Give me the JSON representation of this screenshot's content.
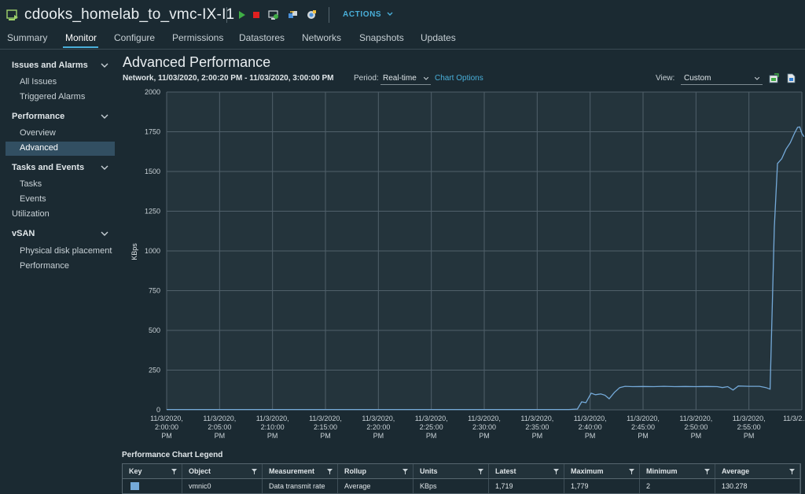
{
  "header": {
    "vm_name": "cdooks_homelab_to_vmc-IX-I1",
    "actions_label": "ACTIONS"
  },
  "tabs": [
    "Summary",
    "Monitor",
    "Configure",
    "Permissions",
    "Datastores",
    "Networks",
    "Snapshots",
    "Updates"
  ],
  "active_tab": "Monitor",
  "sidebar": {
    "groups": [
      {
        "label": "Issues and Alarms",
        "items": [
          "All Issues",
          "Triggered Alarms"
        ]
      },
      {
        "label": "Performance",
        "items": [
          "Overview",
          "Advanced"
        ]
      },
      {
        "label": "Tasks and Events",
        "items": [
          "Tasks",
          "Events"
        ]
      },
      {
        "label": "Utilization"
      },
      {
        "label": "vSAN",
        "items": [
          "Physical disk placement",
          "Performance"
        ]
      }
    ],
    "active_item": "Advanced"
  },
  "page": {
    "title": "Advanced Performance",
    "range": "Network, 11/03/2020, 2:00:20 PM - 11/03/2020, 3:00:00 PM",
    "period_label": "Period:",
    "period_value": "Real-time",
    "chart_options": "Chart Options",
    "view_label": "View:",
    "view_value": "Custom"
  },
  "chart_data": {
    "type": "line",
    "ylabel": "KBps",
    "ylim": [
      0,
      2000
    ],
    "yticks": [
      0,
      250,
      500,
      750,
      1000,
      1250,
      1500,
      1750,
      2000
    ],
    "xticks": [
      [
        "11/3/2020,",
        "2:00:00",
        "PM"
      ],
      [
        "11/3/2020,",
        "2:05:00",
        "PM"
      ],
      [
        "11/3/2020,",
        "2:10:00",
        "PM"
      ],
      [
        "11/3/2020,",
        "2:15:00",
        "PM"
      ],
      [
        "11/3/2020,",
        "2:20:00",
        "PM"
      ],
      [
        "11/3/2020,",
        "2:25:00",
        "PM"
      ],
      [
        "11/3/2020,",
        "2:30:00",
        "PM"
      ],
      [
        "11/3/2020,",
        "2:35:00",
        "PM"
      ],
      [
        "11/3/2020,",
        "2:40:00",
        "PM"
      ],
      [
        "11/3/2020,",
        "2:45:00",
        "PM"
      ],
      [
        "11/3/2020,",
        "2:50:00",
        "PM"
      ],
      [
        "11/3/2020,",
        "2:55:00",
        "PM"
      ],
      [
        "11/3/2..."
      ]
    ],
    "xlim": [
      0,
      60
    ],
    "grid": true,
    "series": [
      {
        "name": "vmnic0",
        "color": "#74a9d8",
        "points": [
          [
            0,
            2
          ],
          [
            5,
            2
          ],
          [
            10,
            2
          ],
          [
            15,
            2
          ],
          [
            20,
            2
          ],
          [
            25,
            2
          ],
          [
            30,
            2
          ],
          [
            35,
            2
          ],
          [
            38,
            2
          ],
          [
            38.8,
            5
          ],
          [
            39.2,
            50
          ],
          [
            39.6,
            45
          ],
          [
            40.1,
            105
          ],
          [
            40.5,
            95
          ],
          [
            41.0,
            100
          ],
          [
            41.4,
            92
          ],
          [
            41.8,
            70
          ],
          [
            42.3,
            110
          ],
          [
            42.8,
            140
          ],
          [
            43.3,
            148
          ],
          [
            44,
            146
          ],
          [
            45,
            147
          ],
          [
            46,
            146
          ],
          [
            47,
            148
          ],
          [
            48,
            146
          ],
          [
            49,
            147
          ],
          [
            50,
            146
          ],
          [
            51,
            147
          ],
          [
            52,
            146
          ],
          [
            52.5,
            140
          ],
          [
            53,
            146
          ],
          [
            53.5,
            125
          ],
          [
            54,
            150
          ],
          [
            55,
            148
          ],
          [
            56,
            148
          ],
          [
            56.6,
            140
          ],
          [
            57.0,
            130
          ],
          [
            57.4,
            1150
          ],
          [
            57.7,
            1550
          ],
          [
            58.1,
            1580
          ],
          [
            58.5,
            1640
          ],
          [
            58.9,
            1680
          ],
          [
            59.3,
            1740
          ],
          [
            59.6,
            1778
          ],
          [
            59.8,
            1780
          ],
          [
            60.0,
            1740
          ],
          [
            60.2,
            1719
          ]
        ]
      }
    ]
  },
  "legend": {
    "title": "Performance Chart Legend",
    "columns": [
      "Key",
      "Object",
      "Measurement",
      "Rollup",
      "Units",
      "Latest",
      "Maximum",
      "Minimum",
      "Average"
    ],
    "rows": [
      {
        "color": "#74a9d8",
        "cells": [
          "",
          "vmnic0",
          "Data transmit rate",
          "Average",
          "KBps",
          "1,719",
          "1,779",
          "2",
          "130.278"
        ]
      }
    ]
  }
}
